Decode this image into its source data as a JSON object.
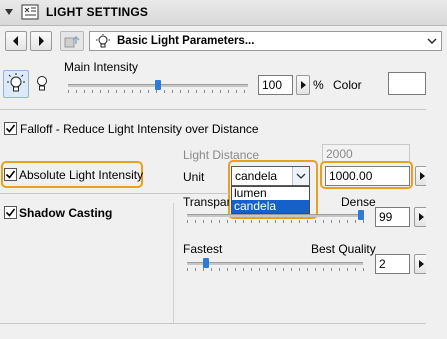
{
  "header": {
    "title": "LIGHT SETTINGS",
    "collapse_icon": "triangle-down-icon",
    "panel_icon": "light-settings-icon"
  },
  "toolbar": {
    "page_label": "Basic Light Parameters...",
    "prev_icon": "arrow-left-icon",
    "next_icon": "arrow-right-icon",
    "favorites_icon": "favorites-icon",
    "page_icon": "light-bulb-icon",
    "dropdown_icon": "chevron-down-icon"
  },
  "intensity": {
    "label": "Main Intensity",
    "value": "100",
    "unit": "%",
    "slider_fraction": 0.5
  },
  "color": {
    "label": "Color",
    "swatch": "#ffffff"
  },
  "falloff": {
    "label": "Falloff - Reduce Light Intensity over Distance",
    "checked": true,
    "distance_label": "Light Distance",
    "distance_value": "2000"
  },
  "absolute": {
    "label": "Absolute Light Intensity",
    "checked": true,
    "unit_label": "Unit",
    "unit_value": "candela",
    "unit_options": [
      "lumen",
      "candela"
    ],
    "selected_option": "candela",
    "value": "1000.00",
    "value_unit": "cd"
  },
  "shadow": {
    "label": "Shadow Casting",
    "checked": true,
    "transparency_label": "Transparency",
    "dense_label": "Dense",
    "transparency_value": "99",
    "transparency_unit": "%",
    "transparency_fraction": 0.99,
    "fastest_label": "Fastest",
    "best_label": "Best Quality",
    "quality_value": "2",
    "quality_fraction": 0.11
  },
  "colors": {
    "highlight": "#e8a020",
    "accent": "#2b7bd7",
    "selection": "#1660c9"
  }
}
